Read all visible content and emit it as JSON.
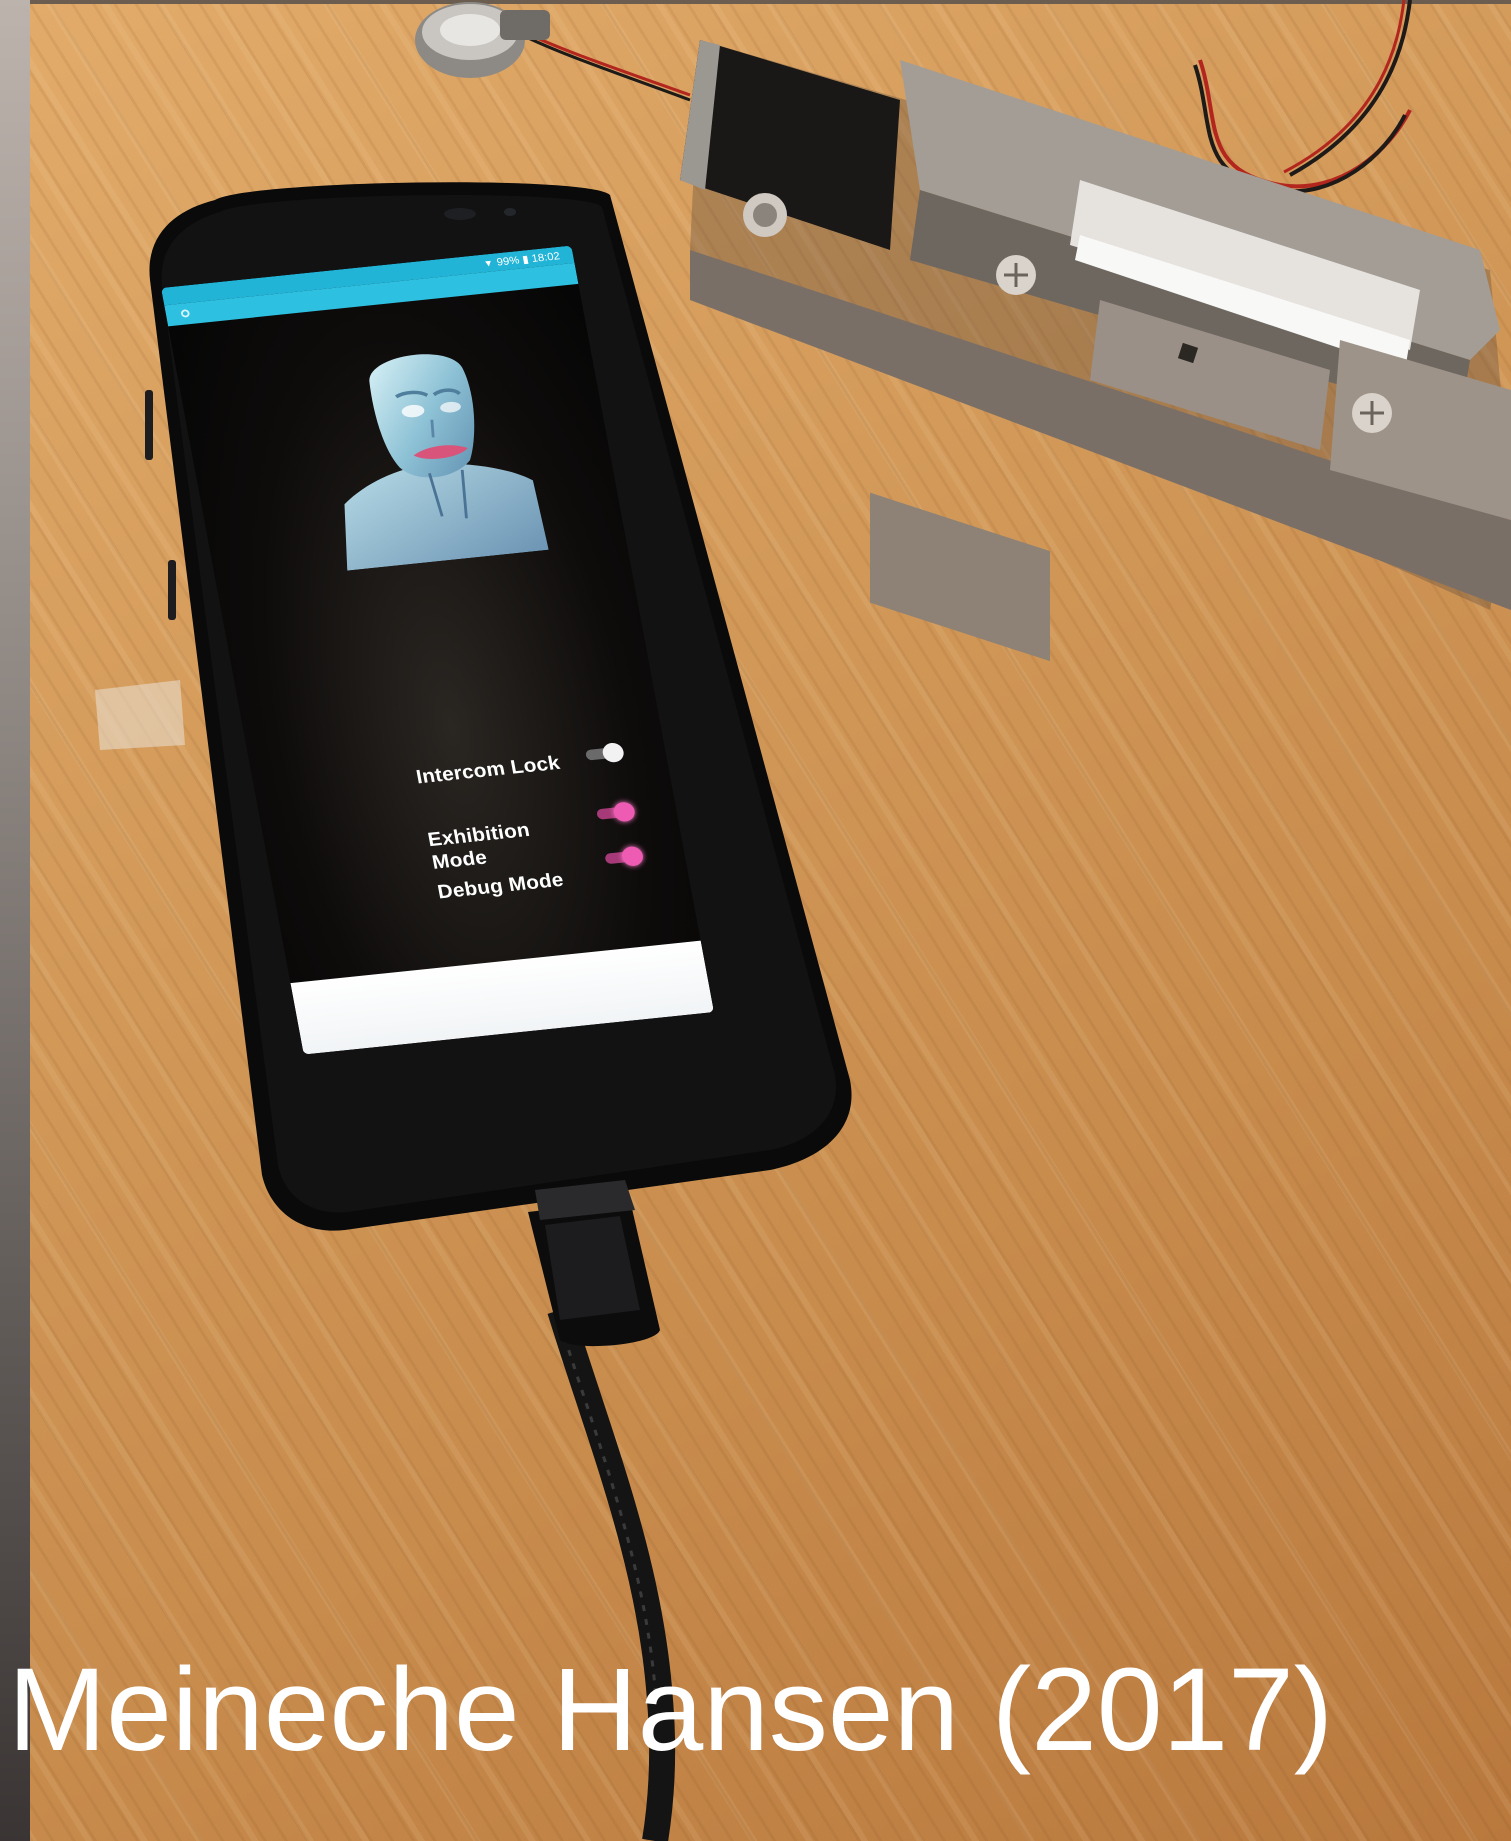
{
  "caption": "Meineche Hansen (2017)",
  "phone": {
    "status_text": "99% ▮ 18:02",
    "settings": [
      {
        "label": "Intercom Lock",
        "toggle": "off"
      },
      {
        "label": "Exhibition Mode",
        "toggle": "on"
      },
      {
        "label": "Debug Mode",
        "toggle": "on"
      }
    ],
    "header_color": "#22b4d6",
    "toggle_on_color": "#ee5bb3"
  }
}
